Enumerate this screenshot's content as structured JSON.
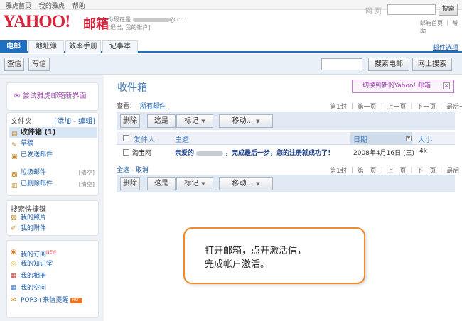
{
  "topbar": {
    "links": [
      "雅虎首页",
      "我的雅虎",
      "帮助"
    ]
  },
  "header": {
    "logo": "YAHOO!",
    "product": "邮箱",
    "account_line1": "你现在是",
    "account_suffix": "@.cn",
    "account_line2": "[退出, 我的帐户]",
    "web_label": "网 页",
    "web_search_value": "",
    "search_button": "搜索",
    "help_links": "邮箱首页 ｜ 帮助"
  },
  "tabs": [
    {
      "label": "电邮",
      "active": true
    },
    {
      "label": "地址簿",
      "active": false
    },
    {
      "label": "效率手册",
      "active": false
    },
    {
      "label": "记事本",
      "active": false
    }
  ],
  "mail_options": "邮件选项",
  "toolbar": {
    "check_mail": "查信",
    "compose": "写信",
    "search_mail_value": "",
    "search_mail": "搜索电邮",
    "search_web": "网上搜索"
  },
  "sidebar": {
    "try_new": "尝试雅虎邮箱新界面",
    "folders_header": "文件夹",
    "folders_add_edit": "[添加 - 编辑]",
    "folders": [
      {
        "label": "收件箱",
        "count": "(1)",
        "icon": "inbox-icon",
        "active": true,
        "clear": ""
      },
      {
        "label": "草稿",
        "count": "",
        "icon": "draft-icon",
        "active": false,
        "clear": ""
      },
      {
        "label": "已发送邮件",
        "count": "",
        "icon": "sent-icon",
        "active": false,
        "clear": ""
      },
      {
        "label": "垃圾邮件",
        "count": "",
        "icon": "spam-icon",
        "active": false,
        "clear": "[清空]"
      },
      {
        "label": "已删除邮件",
        "count": "",
        "icon": "trash-icon",
        "active": false,
        "clear": "[清空]"
      }
    ],
    "quick_header": "搜索快捷键",
    "quick_links": [
      {
        "label": "我的照片",
        "icon": "photo-icon"
      },
      {
        "label": "我的附件",
        "icon": "attachment-icon"
      }
    ],
    "misc_links": [
      {
        "label": "我的订阅",
        "icon": "rss-icon",
        "tag": "NEW"
      },
      {
        "label": "我的知识堂",
        "icon": "bulb-icon",
        "tag": ""
      },
      {
        "label": "我的相册",
        "icon": "album-icon",
        "tag": ""
      },
      {
        "label": "我的空间",
        "icon": "space-icon",
        "tag": ""
      },
      {
        "label": "POP3+来信提醒",
        "icon": "pop3-icon",
        "tag": "HOT"
      }
    ]
  },
  "main": {
    "title": "收件箱",
    "switch_label": "切换到新的Yahoo! 邮箱",
    "view_label": "查看：",
    "view_value": "所有邮件",
    "pager": [
      "第1封",
      "第一页",
      "上一页",
      "下一页",
      "最后一页"
    ],
    "actions": {
      "delete": "删除",
      "spam": "这是",
      "mark": "标记",
      "move": "移动..."
    },
    "columns": {
      "sender": "发件人",
      "subject": "主题",
      "date": "日期",
      "size": "大小"
    },
    "messages": [
      {
        "sender": "淘宝网",
        "subject_prefix": "亲爱的",
        "subject_rest": "，完成最后一步，您的注册就成功了！",
        "date": "2008年4月16日 (三)",
        "size": "4k"
      }
    ],
    "select_all": "全选 - 取消"
  },
  "callout": {
    "line1": "打开邮箱，点开激活信，",
    "line2": "完成帐户激活。"
  }
}
